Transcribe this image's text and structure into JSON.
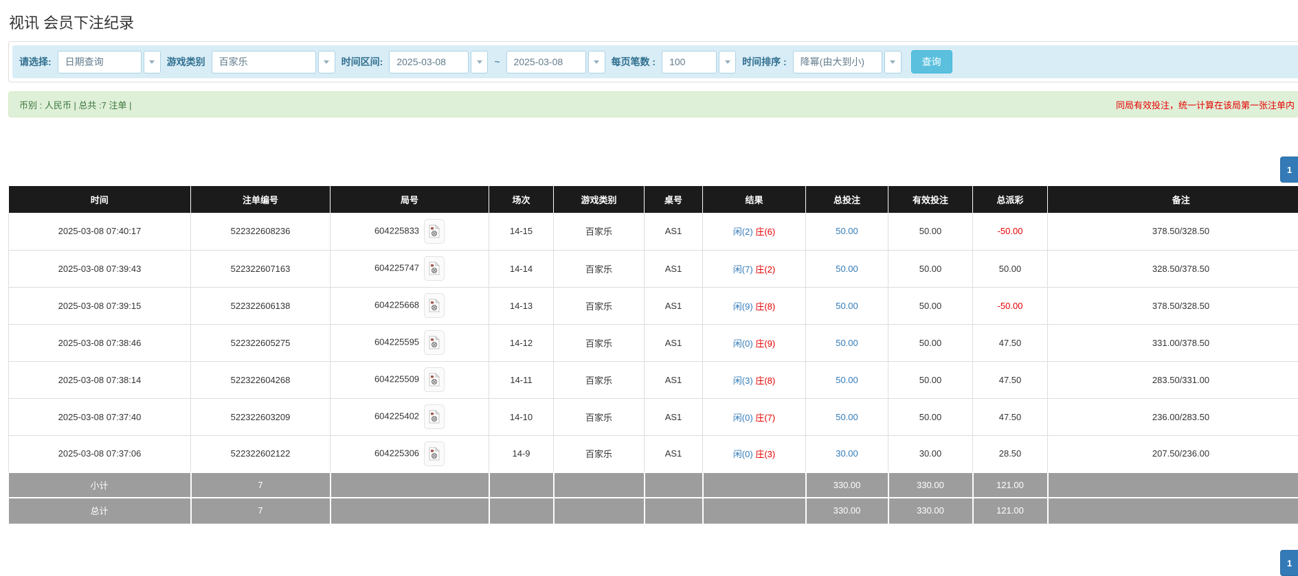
{
  "page": {
    "title": "视讯 会员下注纪录"
  },
  "colors": {
    "search_button": "#5bc0de",
    "pagination_button": "#337ab7",
    "filter_bar_bg": "#d9edf7",
    "info_bar_bg": "#dff0d8",
    "header_bg": "#1b1b1b",
    "summary_bg": "#9d9d9d",
    "bet_amount_blue": "#337ab7",
    "loss_red": "#e60000",
    "player_blue": "#337ab7",
    "banker_red": "#e60000"
  },
  "filters": {
    "select_type": {
      "label": "请选择:",
      "value": "日期查询"
    },
    "game_category": {
      "label": "游戏类别",
      "value": "百家乐"
    },
    "date_range": {
      "label": "时间区间:",
      "from": "2025-03-08",
      "tilde": "~",
      "to": "2025-03-08"
    },
    "page_size": {
      "label": "每页笔数 :",
      "value": "100"
    },
    "time_order": {
      "label": "时间排序 :",
      "value": "降幂(由大到小)"
    },
    "search_button": "查询"
  },
  "info_bar": {
    "left": "币别 : 人民币 | 总共 :7 注单 |",
    "right": "同局有效投注，统一计算在该局第一张注单内"
  },
  "pagination": {
    "page": "1"
  },
  "table": {
    "headers": [
      "时间",
      "注单编号",
      "局号",
      "场次",
      "游戏类别",
      "桌号",
      "结果",
      "总投注",
      "有效投注",
      "总派彩",
      "备注"
    ],
    "rows": [
      {
        "time": "2025-03-08 07:40:17",
        "bet_id": "522322608236",
        "round": "604225833",
        "session": "14-15",
        "game": "百家乐",
        "table_no": "AS1",
        "result_player": "闲(2)",
        "result_banker": "庄(6)",
        "total_bet": "50.00",
        "valid_bet": "50.00",
        "payout": "-50.00",
        "remark": "378.50/328.50"
      },
      {
        "time": "2025-03-08 07:39:43",
        "bet_id": "522322607163",
        "round": "604225747",
        "session": "14-14",
        "game": "百家乐",
        "table_no": "AS1",
        "result_player": "闲(7)",
        "result_banker": "庄(2)",
        "total_bet": "50.00",
        "valid_bet": "50.00",
        "payout": "50.00",
        "remark": "328.50/378.50"
      },
      {
        "time": "2025-03-08 07:39:15",
        "bet_id": "522322606138",
        "round": "604225668",
        "session": "14-13",
        "game": "百家乐",
        "table_no": "AS1",
        "result_player": "闲(9)",
        "result_banker": "庄(8)",
        "total_bet": "50.00",
        "valid_bet": "50.00",
        "payout": "-50.00",
        "remark": "378.50/328.50"
      },
      {
        "time": "2025-03-08 07:38:46",
        "bet_id": "522322605275",
        "round": "604225595",
        "session": "14-12",
        "game": "百家乐",
        "table_no": "AS1",
        "result_player": "闲(0)",
        "result_banker": "庄(9)",
        "total_bet": "50.00",
        "valid_bet": "50.00",
        "payout": "47.50",
        "remark": "331.00/378.50"
      },
      {
        "time": "2025-03-08 07:38:14",
        "bet_id": "522322604268",
        "round": "604225509",
        "session": "14-11",
        "game": "百家乐",
        "table_no": "AS1",
        "result_player": "闲(3)",
        "result_banker": "庄(8)",
        "total_bet": "50.00",
        "valid_bet": "50.00",
        "payout": "47.50",
        "remark": "283.50/331.00"
      },
      {
        "time": "2025-03-08 07:37:40",
        "bet_id": "522322603209",
        "round": "604225402",
        "session": "14-10",
        "game": "百家乐",
        "table_no": "AS1",
        "result_player": "闲(0)",
        "result_banker": "庄(7)",
        "total_bet": "50.00",
        "valid_bet": "50.00",
        "payout": "47.50",
        "remark": "236.00/283.50"
      },
      {
        "time": "2025-03-08 07:37:06",
        "bet_id": "522322602122",
        "round": "604225306",
        "session": "14-9",
        "game": "百家乐",
        "table_no": "AS1",
        "result_player": "闲(0)",
        "result_banker": "庄(3)",
        "total_bet": "30.00",
        "valid_bet": "30.00",
        "payout": "28.50",
        "remark": "207.50/236.00"
      }
    ],
    "subtotal": {
      "label": "小计",
      "count": "7",
      "total_bet": "330.00",
      "valid_bet": "330.00",
      "payout": "121.00"
    },
    "total": {
      "label": "总计",
      "count": "7",
      "total_bet": "330.00",
      "valid_bet": "330.00",
      "payout": "121.00"
    }
  }
}
